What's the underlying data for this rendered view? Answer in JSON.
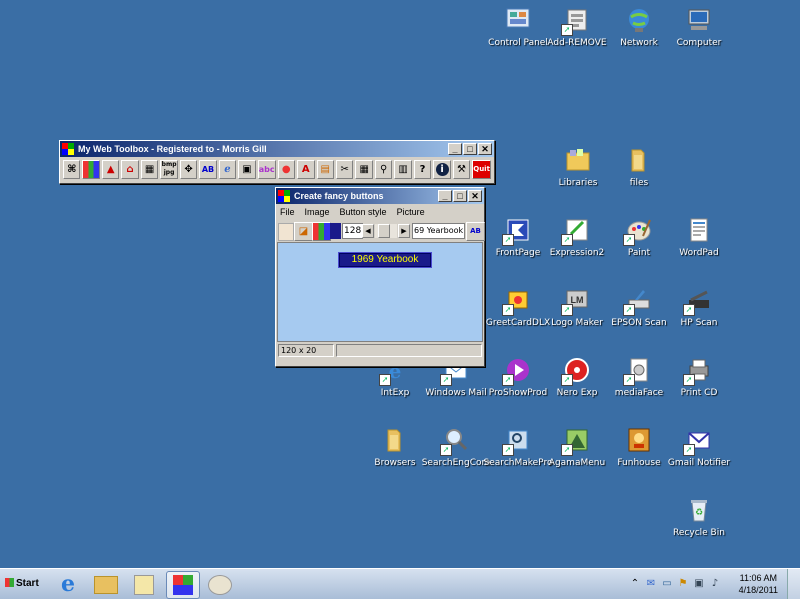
{
  "desktop_icons": [
    {
      "label": "Control Panel",
      "icon": "control-panel-icon"
    },
    {
      "label": "Add-REMOVE",
      "icon": "add-remove-icon"
    },
    {
      "label": "Network",
      "icon": "network-icon"
    },
    {
      "label": "Computer",
      "icon": "computer-icon"
    },
    {
      "label": "Libraries",
      "icon": "libraries-icon"
    },
    {
      "label": "files",
      "icon": "folder-icon"
    },
    {
      "label": "FrontPage",
      "icon": "frontpage-icon"
    },
    {
      "label": "Expression2",
      "icon": "expression-icon"
    },
    {
      "label": "Paint",
      "icon": "paint-icon"
    },
    {
      "label": "WordPad",
      "icon": "wordpad-icon"
    },
    {
      "label": "GreetCardDLX",
      "icon": "greetcard-icon"
    },
    {
      "label": "Logo Maker",
      "icon": "logo-maker-icon"
    },
    {
      "label": "EPSON Scan",
      "icon": "epson-scan-icon"
    },
    {
      "label": "HP Scan",
      "icon": "hp-scan-icon"
    },
    {
      "label": "IntExp",
      "icon": "intexp-icon"
    },
    {
      "label": "Windows Mail",
      "icon": "windows-mail-icon"
    },
    {
      "label": "ProShowProd",
      "icon": "proshow-icon"
    },
    {
      "label": "Nero Exp",
      "icon": "nero-icon"
    },
    {
      "label": "mediaFace",
      "icon": "mediaface-icon"
    },
    {
      "label": "Print CD",
      "icon": "print-cd-icon"
    },
    {
      "label": "Browsers",
      "icon": "folder-icon"
    },
    {
      "label": "SearchEngCom",
      "icon": "search-eng-icon"
    },
    {
      "label": "SearchMakePro",
      "icon": "search-make-icon"
    },
    {
      "label": "AgamaMenu",
      "icon": "agama-menu-icon"
    },
    {
      "label": "Funhouse",
      "icon": "funhouse-icon"
    },
    {
      "label": "Gmail Notifier",
      "icon": "gmail-notifier-icon"
    },
    {
      "label": "Recycle Bin",
      "icon": "recycle-bin-icon"
    }
  ],
  "toolbox": {
    "title": "My Web Toolbox - Registered to - Morris Gill",
    "buttons": [
      "binoculars",
      "grid",
      "shapes",
      "pdf",
      "grid2",
      "bmp-jpg",
      "move",
      "ab",
      "ie",
      "monitor",
      "abc",
      "palette",
      "text-a",
      "card",
      "scissors",
      "calculator",
      "magnifier",
      "film",
      "help",
      "info",
      "tools",
      "quit"
    ],
    "bmp_label": "bmp",
    "jpg_label": "jpg",
    "quit_label": "Quit",
    "help_label": "?",
    "info_label": "i"
  },
  "fancy": {
    "title": "Create fancy buttons",
    "menu": [
      "File",
      "Image",
      "Button style",
      "Picture"
    ],
    "width_value": "128",
    "text_value": "69 Yearbook",
    "preview_label": "1969 Yearbook",
    "status_size": "120 x 20",
    "ab_label": "AB"
  },
  "taskbar": {
    "start_label": "Start",
    "clock_time": "11:06 AM",
    "clock_date": "4/18/2011"
  },
  "colors": {
    "desktop": "#3a6ea5",
    "titlebar": "#0a246a",
    "fancy_button_bg": "#1a1a8a",
    "fancy_button_text": "#ffff00"
  }
}
